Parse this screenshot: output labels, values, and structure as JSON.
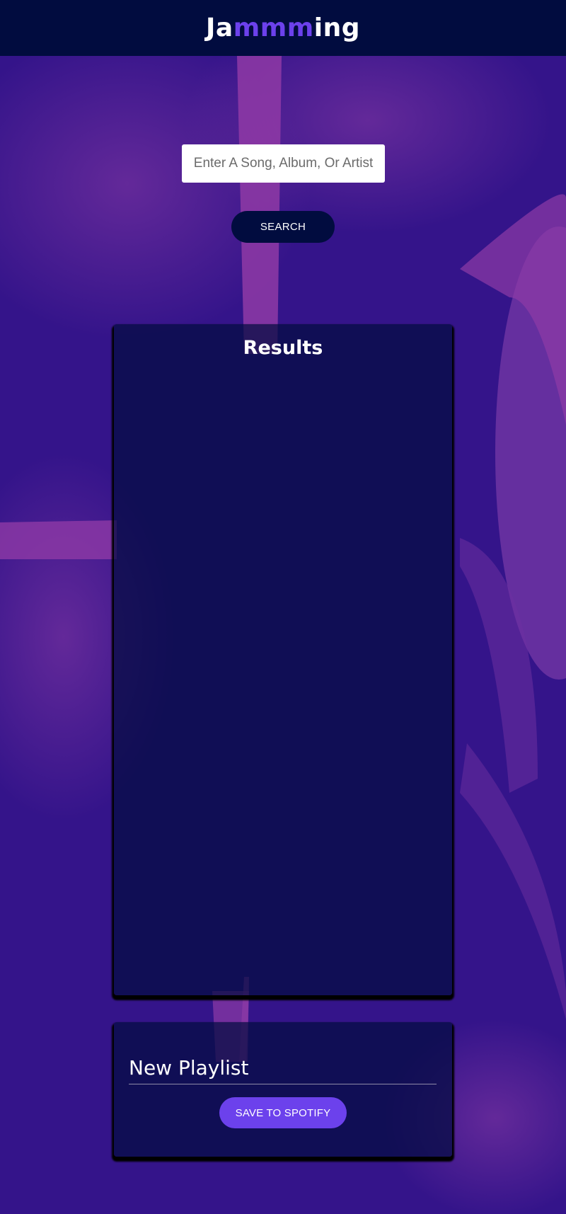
{
  "header": {
    "logo_prefix": "Ja",
    "logo_highlight": "mmm",
    "logo_suffix": "ing"
  },
  "search": {
    "placeholder": "Enter A Song, Album, Or Artist",
    "button_label": "SEARCH"
  },
  "results": {
    "title": "Results",
    "tracks": []
  },
  "playlist": {
    "name": "New Playlist",
    "save_label": "SAVE TO SPOTIFY"
  },
  "colors": {
    "header_bg": "#010c3f",
    "accent": "#6c41ec",
    "page_bg": "#34148a",
    "panel_bg": "#010c3f"
  }
}
